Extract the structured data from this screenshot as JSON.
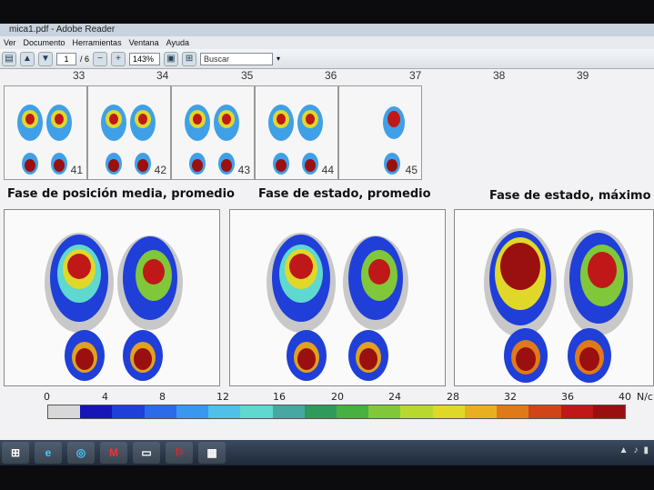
{
  "window": {
    "title": "mica1.pdf - Adobe Reader"
  },
  "menu": {
    "items": [
      "Ver",
      "Documento",
      "Herramientas",
      "Ventana",
      "Ayuda"
    ]
  },
  "toolbar": {
    "page_current": "1",
    "page_total": "/ 6",
    "zoom": "143%",
    "search_placeholder": "Buscar"
  },
  "top_row_numbers": [
    "33",
    "34",
    "35",
    "36",
    "37",
    "38",
    "39"
  ],
  "thumbnails": [
    "41",
    "42",
    "43",
    "44",
    "45"
  ],
  "headings": [
    "Fase de posición media, promedio",
    "Fase de estado, promedio",
    "Fase de estado, máximo"
  ],
  "legend": {
    "ticks": [
      "0",
      "4",
      "8",
      "12",
      "16",
      "20",
      "24",
      "28",
      "32",
      "36",
      "40"
    ],
    "unit": "N/c",
    "colors": [
      "#d8d8d8",
      "#1515b8",
      "#1f3fd8",
      "#2b6bea",
      "#3a97f0",
      "#4fc0e8",
      "#5fd8d0",
      "#46a8a0",
      "#2f9a5a",
      "#47b040",
      "#80c83a",
      "#b8d830",
      "#e0d828",
      "#e8b020",
      "#e07a18",
      "#d04418",
      "#c01818",
      "#9a1010"
    ]
  },
  "taskbar": {
    "apps": [
      "start-orb",
      "ie",
      "explorer",
      "mcafee",
      "window",
      "acrobat",
      "doc"
    ]
  }
}
